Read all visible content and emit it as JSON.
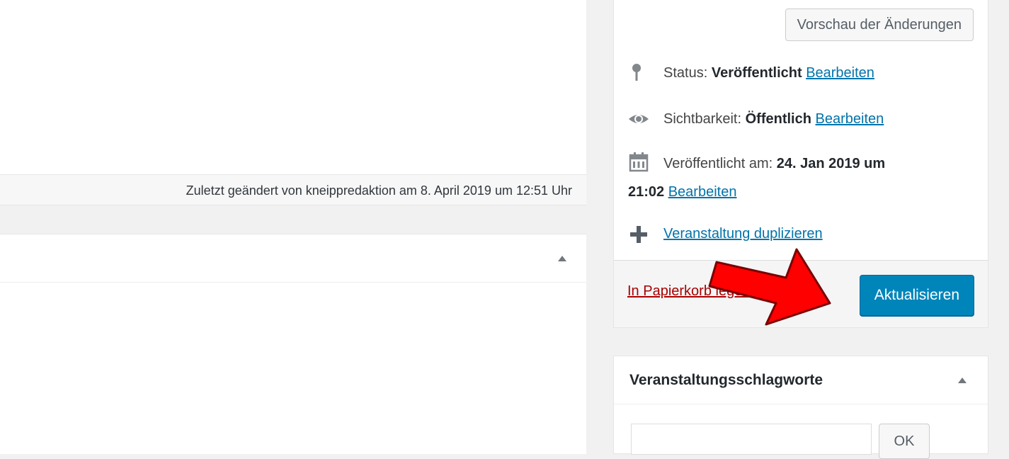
{
  "editor": {
    "last_edit_text": "Zuletzt geändert von kneippredaktion am 8. April 2019 um 12:51 Uhr"
  },
  "publish": {
    "preview_label": "Vorschau der Änderungen",
    "status_label": "Status:",
    "status_value": "Veröffentlicht",
    "visibility_label": "Sichtbarkeit:",
    "visibility_value": "Öffentlich",
    "published_label": "Veröffentlicht am:",
    "published_value_line1": "24. Jan 2019 um",
    "published_value_line2": "21:02",
    "edit_link": "Bearbeiten",
    "duplicate_link": "Veranstaltung duplizieren",
    "trash_link": "In Papierkorb legen",
    "update_label": "Aktualisieren"
  },
  "tags_box": {
    "title": "Veranstaltungsschlagworte",
    "ok_label": "OK"
  },
  "colors": {
    "accent": "#0085ba",
    "link": "#0073aa",
    "trash": "#a00",
    "annotation_arrow": "#ff0000"
  },
  "icons": [
    "pin-icon",
    "eye-icon",
    "calendar-icon",
    "plus-icon",
    "collapse-arrow-icon",
    "annotation-arrow-icon"
  ]
}
